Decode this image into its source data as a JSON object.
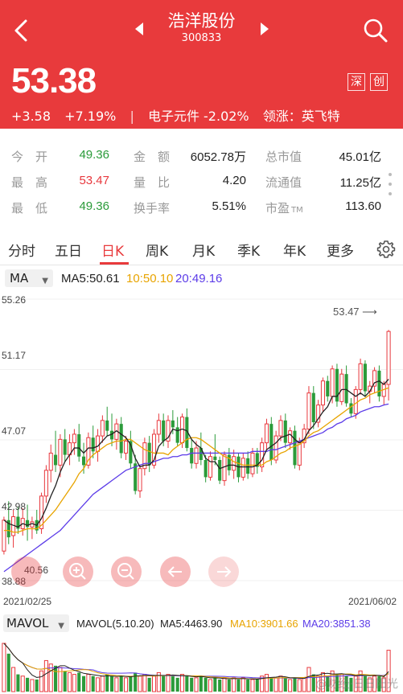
{
  "header": {
    "stock_name": "浩洋股份",
    "stock_code": "300833",
    "price": "53.38",
    "change": "+3.58",
    "change_pct": "+7.19%",
    "separator": "|",
    "sector": "电子元件 -2.02%",
    "leader": "领涨：英飞特",
    "tag_sz": "深",
    "tag_cy": "创"
  },
  "stats": {
    "open_label": "今　开",
    "open": "49.36",
    "high_label": "最　高",
    "high": "53.47",
    "low_label": "最　低",
    "low": "49.36",
    "amount_label": "金　额",
    "amount": "6052.78万",
    "vol_ratio_label": "量　比",
    "vol_ratio": "4.20",
    "turnover_label": "换手率",
    "turnover": "5.51%",
    "mcap_label": "总市值",
    "mcap": "45.01亿",
    "float_label": "流通值",
    "float_mcap": "11.25亿",
    "pe_label": "市盈",
    "pe_suffix": "TM",
    "pe": "113.60"
  },
  "tabs": [
    "分时",
    "五日",
    "日K",
    "周K",
    "月K",
    "季K",
    "年K",
    "更多"
  ],
  "active_tab": "日K",
  "ma": {
    "select": "MA",
    "ma5": "MA5:50.61",
    "ma10": "10:50.10",
    "ma20": "20:49.16",
    "ma5_color": "#222222",
    "ma10_color": "#e8a400",
    "ma20_color": "#5c3ce8"
  },
  "chart_data": {
    "type": "candlestick",
    "y_ticks": [
      "55.26",
      "51.17",
      "47.07",
      "42.98",
      "38.88"
    ],
    "ylim": [
      38.88,
      55.26
    ],
    "max_label": "53.47",
    "min_label": "40.56",
    "x_start": "2021/02/25",
    "x_end": "2021/06/02",
    "candles": [
      [
        40.6,
        42.6,
        40.4,
        42.4
      ],
      [
        42.4,
        43.5,
        41.0,
        41.4
      ],
      [
        41.5,
        43.0,
        40.8,
        42.6
      ],
      [
        42.6,
        43.2,
        41.6,
        41.9
      ],
      [
        41.9,
        43.1,
        41.5,
        42.5
      ],
      [
        42.4,
        43.3,
        41.2,
        42.0
      ],
      [
        42.0,
        42.6,
        41.3,
        42.3
      ],
      [
        42.4,
        43.0,
        41.6,
        41.8
      ],
      [
        41.9,
        44.0,
        41.6,
        43.8
      ],
      [
        43.8,
        45.6,
        43.4,
        45.3
      ],
      [
        45.3,
        46.8,
        44.6,
        46.3
      ],
      [
        46.2,
        47.6,
        45.2,
        45.6
      ],
      [
        45.6,
        47.4,
        44.9,
        47.1
      ],
      [
        47.1,
        47.7,
        45.8,
        46.2
      ],
      [
        46.2,
        47.4,
        45.6,
        46.9
      ],
      [
        46.9,
        47.7,
        46.2,
        47.4
      ],
      [
        47.4,
        48.0,
        45.8,
        46.1
      ],
      [
        46.1,
        46.9,
        45.1,
        45.6
      ],
      [
        45.6,
        47.5,
        45.4,
        47.2
      ],
      [
        47.2,
        47.9,
        46.0,
        46.4
      ],
      [
        46.4,
        47.7,
        45.8,
        47.3
      ],
      [
        47.3,
        48.5,
        46.9,
        48.2
      ],
      [
        48.2,
        49.0,
        47.3,
        47.6
      ],
      [
        47.6,
        48.6,
        46.7,
        47.1
      ],
      [
        47.1,
        48.3,
        46.5,
        48.0
      ],
      [
        48.0,
        48.4,
        46.0,
        46.3
      ],
      [
        46.3,
        47.3,
        45.9,
        47.0
      ],
      [
        47.0,
        47.6,
        45.4,
        45.7
      ],
      [
        45.7,
        46.2,
        43.9,
        44.1
      ],
      [
        44.1,
        45.6,
        43.7,
        45.4
      ],
      [
        45.4,
        47.2,
        45.0,
        46.9
      ],
      [
        46.9,
        47.3,
        45.2,
        45.6
      ],
      [
        45.6,
        47.7,
        45.4,
        47.4
      ],
      [
        47.4,
        48.6,
        46.9,
        48.2
      ],
      [
        48.2,
        48.6,
        46.7,
        47.0
      ],
      [
        47.0,
        48.5,
        46.6,
        48.2
      ],
      [
        48.2,
        48.8,
        47.4,
        47.8
      ],
      [
        47.8,
        48.4,
        46.7,
        46.9
      ],
      [
        46.9,
        48.6,
        46.6,
        48.4
      ],
      [
        48.4,
        48.9,
        46.4,
        46.6
      ],
      [
        46.6,
        47.1,
        45.4,
        45.7
      ],
      [
        45.7,
        47.0,
        45.4,
        46.6
      ],
      [
        46.6,
        47.5,
        45.6,
        45.9
      ],
      [
        45.9,
        46.2,
        44.6,
        44.9
      ],
      [
        44.9,
        46.4,
        44.7,
        46.1
      ],
      [
        46.1,
        47.4,
        45.6,
        45.9
      ],
      [
        45.9,
        46.1,
        44.5,
        44.7
      ],
      [
        44.7,
        46.4,
        44.4,
        46.2
      ],
      [
        46.2,
        46.6,
        45.0,
        45.3
      ],
      [
        45.3,
        46.5,
        44.8,
        46.1
      ],
      [
        46.1,
        46.3,
        44.6,
        44.9
      ],
      [
        44.9,
        46.3,
        44.7,
        46.0
      ],
      [
        46.0,
        46.4,
        44.8,
        45.1
      ],
      [
        45.1,
        46.6,
        44.9,
        46.3
      ],
      [
        46.3,
        46.6,
        45.1,
        45.5
      ],
      [
        45.5,
        47.2,
        45.2,
        46.9
      ],
      [
        46.9,
        48.3,
        46.5,
        48.0
      ],
      [
        48.0,
        48.4,
        45.6,
        45.9
      ],
      [
        45.9,
        47.6,
        45.7,
        47.3
      ],
      [
        47.3,
        48.5,
        47.0,
        48.2
      ],
      [
        48.2,
        48.6,
        46.6,
        46.9
      ],
      [
        46.9,
        47.8,
        46.5,
        47.6
      ],
      [
        47.6,
        47.9,
        45.4,
        45.6
      ],
      [
        45.6,
        47.2,
        45.3,
        46.9
      ],
      [
        46.9,
        48.0,
        46.6,
        47.7
      ],
      [
        47.7,
        50.2,
        47.4,
        49.8
      ],
      [
        49.8,
        50.2,
        47.7,
        48.1
      ],
      [
        48.1,
        49.4,
        47.8,
        49.1
      ],
      [
        49.1,
        50.7,
        48.7,
        50.5
      ],
      [
        50.5,
        50.8,
        49.3,
        49.6
      ],
      [
        49.6,
        51.4,
        49.2,
        51.2
      ],
      [
        51.2,
        51.5,
        49.0,
        49.3
      ],
      [
        49.3,
        51.2,
        49.1,
        50.9
      ],
      [
        50.9,
        51.4,
        49.0,
        49.2
      ],
      [
        49.2,
        49.5,
        48.4,
        48.6
      ],
      [
        48.6,
        50.2,
        48.3,
        50.0
      ],
      [
        50.0,
        51.8,
        49.7,
        51.5
      ],
      [
        51.5,
        51.7,
        49.6,
        49.9
      ],
      [
        49.9,
        50.5,
        49.2,
        50.2
      ],
      [
        50.2,
        51.3,
        49.8,
        51.1
      ],
      [
        51.1,
        51.4,
        49.3,
        49.6
      ],
      [
        49.6,
        50.5,
        49.1,
        50.3
      ],
      [
        50.3,
        53.47,
        49.36,
        53.38
      ]
    ],
    "ma5": [
      42.4,
      42.2,
      42.1,
      42.0,
      42.2,
      42.1,
      42.2,
      42.1,
      42.5,
      43.1,
      43.8,
      44.4,
      45.2,
      45.8,
      46.2,
      46.6,
      46.6,
      46.3,
      46.6,
      46.6,
      46.7,
      47.0,
      47.3,
      47.4,
      47.6,
      47.4,
      47.2,
      46.8,
      46.0,
      45.5,
      45.6,
      45.6,
      45.9,
      46.7,
      47.0,
      47.2,
      47.7,
      47.6,
      47.7,
      47.6,
      47.1,
      46.8,
      46.6,
      46.0,
      45.8,
      45.8,
      45.4,
      45.5,
      45.6,
      45.6,
      45.5,
      45.5,
      45.5,
      45.5,
      45.6,
      45.9,
      46.5,
      46.7,
      46.9,
      47.2,
      47.3,
      47.4,
      47.1,
      46.9,
      47.1,
      47.6,
      47.9,
      48.3,
      48.7,
      49.0,
      49.6,
      49.6,
      50.0,
      50.0,
      49.8,
      49.6,
      49.8,
      49.6,
      49.9,
      50.4,
      50.5,
      50.3,
      50.6
    ],
    "ma10": [
      41.8,
      41.8,
      41.7,
      41.7,
      41.8,
      41.9,
      41.9,
      41.9,
      42.1,
      42.4,
      42.7,
      43.0,
      43.4,
      43.8,
      44.2,
      44.6,
      45.1,
      45.4,
      45.9,
      46.2,
      46.4,
      46.6,
      46.8,
      46.9,
      47.0,
      47.0,
      47.1,
      47.1,
      46.9,
      46.7,
      46.5,
      46.4,
      46.3,
      46.3,
      46.3,
      46.2,
      46.5,
      46.7,
      46.9,
      47.1,
      47.2,
      47.2,
      47.1,
      46.9,
      46.7,
      46.5,
      46.3,
      46.1,
      46.0,
      45.8,
      45.7,
      45.6,
      45.6,
      45.6,
      45.6,
      45.6,
      45.8,
      45.9,
      46.1,
      46.3,
      46.4,
      46.6,
      46.7,
      46.8,
      47.0,
      47.3,
      47.5,
      47.6,
      47.8,
      48.0,
      48.2,
      48.4,
      48.6,
      48.8,
      49.0,
      49.2,
      49.4,
      49.5,
      49.7,
      49.8,
      49.9,
      50.0,
      50.1
    ],
    "ma20": [
      39.4,
      39.6,
      39.8,
      40.0,
      40.2,
      40.4,
      40.6,
      40.8,
      41.0,
      41.2,
      41.4,
      41.6,
      41.8,
      42.1,
      42.4,
      42.7,
      43.0,
      43.3,
      43.6,
      43.9,
      44.1,
      44.3,
      44.5,
      44.7,
      44.9,
      45.1,
      45.3,
      45.4,
      45.5,
      45.6,
      45.7,
      45.7,
      45.8,
      45.9,
      46.0,
      46.0,
      46.1,
      46.1,
      46.2,
      46.2,
      46.3,
      46.3,
      46.3,
      46.3,
      46.3,
      46.3,
      46.3,
      46.3,
      46.3,
      46.3,
      46.3,
      46.3,
      46.3,
      46.4,
      46.4,
      46.4,
      46.4,
      46.5,
      46.5,
      46.6,
      46.7,
      46.8,
      46.9,
      47.0,
      47.1,
      47.2,
      47.3,
      47.4,
      47.5,
      47.7,
      47.8,
      48.0,
      48.1,
      48.3,
      48.4,
      48.5,
      48.7,
      48.8,
      48.9,
      49.0,
      49.0,
      49.1,
      49.16
    ]
  },
  "volume": {
    "select": "MAVOL",
    "params": "MAVOL(5.10.20)",
    "ma5": "MA5:4463.90",
    "ma10": "MA10:3901.66",
    "ma20": "MA20:3851.38",
    "bars": [
      28,
      22,
      14,
      10,
      9,
      8,
      7,
      7,
      12,
      18,
      16,
      15,
      14,
      12,
      11,
      10,
      11,
      9,
      10,
      9,
      8,
      9,
      10,
      9,
      8,
      9,
      8,
      9,
      11,
      9,
      10,
      8,
      9,
      11,
      9,
      10,
      9,
      8,
      10,
      9,
      8,
      8,
      9,
      8,
      7,
      8,
      7,
      8,
      7,
      8,
      7,
      8,
      7,
      7,
      7,
      9,
      10,
      8,
      8,
      9,
      8,
      7,
      8,
      7,
      8,
      14,
      10,
      9,
      11,
      9,
      12,
      10,
      10,
      9,
      8,
      9,
      12,
      9,
      8,
      9,
      9,
      8,
      24
    ]
  },
  "zoom_controls": [
    "zoom-in-icon",
    "zoom-out-icon",
    "arrow-left-icon",
    "arrow-right-icon"
  ],
  "watermark": "@财经·日日阳光"
}
